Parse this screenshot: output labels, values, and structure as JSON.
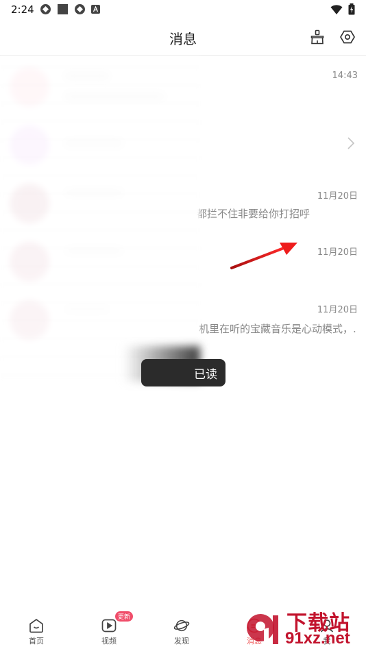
{
  "status_bar": {
    "time": "2:24"
  },
  "header": {
    "title": "消息"
  },
  "messages": [
    {
      "time": "14:43",
      "preview": "",
      "avatar_color": "#ffc4cf"
    },
    {
      "time": "",
      "preview": "",
      "avatar_color": "#e3b6f5",
      "has_chevron": true
    },
    {
      "time": "11月20日",
      "preview": "都拦不住非要给你打招呼",
      "avatar_color": "#c98c9c"
    },
    {
      "time": "11月20日",
      "preview": "",
      "avatar_color": "#d08a9e"
    },
    {
      "time": "11月20日",
      "preview": "机里在听的宝藏音乐是心动模式，...",
      "avatar_color": "#d08a9e"
    }
  ],
  "toast": {
    "text": "已读"
  },
  "bottom_nav": {
    "items": [
      {
        "label": "首页",
        "icon": "home-icon"
      },
      {
        "label": "视频",
        "icon": "video-play-icon",
        "badge": "更新"
      },
      {
        "label": "发现",
        "icon": "planet-icon"
      },
      {
        "label": "消息",
        "icon": "message-icon",
        "active": true
      },
      {
        "label": "我",
        "icon": "profile-icon"
      }
    ]
  },
  "watermark": {
    "title": "下载站",
    "url": "91xz.net"
  },
  "colors": {
    "accent": "#f06060",
    "badge": "#f04d6a",
    "watermark": "#c2132d",
    "annotation": "#e02020"
  }
}
